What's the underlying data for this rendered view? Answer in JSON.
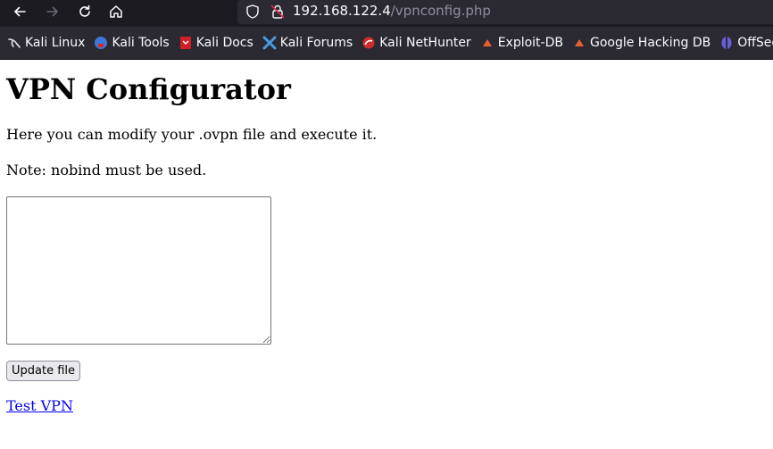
{
  "browser": {
    "url_host": "192.168.122.4",
    "url_path": "/vpnconfig.php",
    "bookmarks": [
      {
        "label": "Kali Linux",
        "icon": "kali-dragon-icon",
        "color": "#e6e6e6"
      },
      {
        "label": "Kali Tools",
        "icon": "kali-tools-icon",
        "color": "#3e76d8"
      },
      {
        "label": "Kali Docs",
        "icon": "kali-docs-icon",
        "color": "#d01f27"
      },
      {
        "label": "Kali Forums",
        "icon": "kali-forums-icon",
        "color": "#4a9be0"
      },
      {
        "label": "Kali NetHunter",
        "icon": "nethunter-icon",
        "color": "#d02b2b"
      },
      {
        "label": "Exploit-DB",
        "icon": "exploit-db-icon",
        "color": "#e6622a"
      },
      {
        "label": "Google Hacking DB",
        "icon": "ghdb-icon",
        "color": "#e6622a"
      },
      {
        "label": "OffSec",
        "icon": "offsec-icon",
        "color": "#6a5fd8"
      }
    ]
  },
  "page": {
    "title": "VPN Configurator",
    "intro": "Here you can modify your .ovpn file and execute it.",
    "note": "Note: nobind must be used.",
    "textarea_value": "",
    "update_button": "Update file",
    "test_link": "Test VPN"
  }
}
